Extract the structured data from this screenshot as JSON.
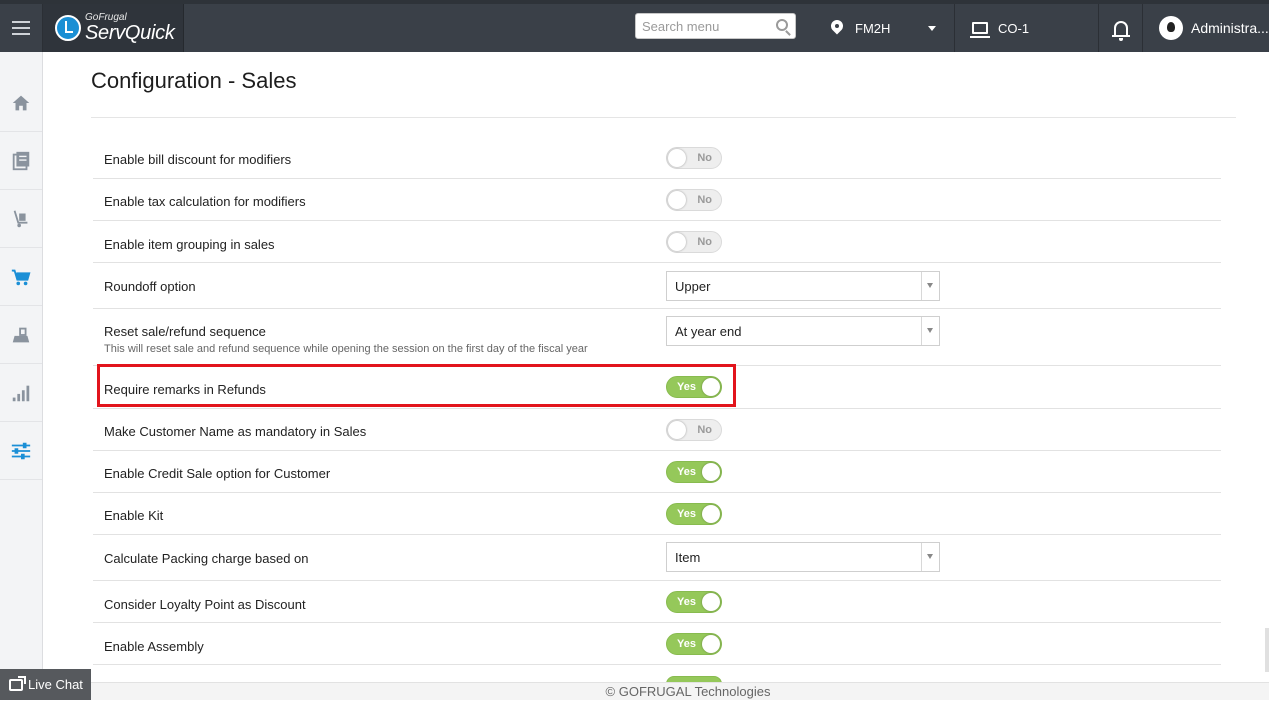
{
  "topbar": {
    "logo_small": "GoFrugal",
    "logo_big": "ServQuick",
    "search_placeholder": "Search menu",
    "location": "FM2H",
    "counter": "CO-1",
    "user": "Administra..."
  },
  "sidebar": {
    "items": [
      {
        "name": "home-icon"
      },
      {
        "name": "catalog-icon"
      },
      {
        "name": "inventory-icon"
      },
      {
        "name": "sales-cart-icon"
      },
      {
        "name": "purchase-icon"
      },
      {
        "name": "reports-icon"
      },
      {
        "name": "settings-icon"
      }
    ],
    "active": "settings-icon"
  },
  "page": {
    "title": "Configuration - Sales"
  },
  "settings": [
    {
      "label": "Enable bill discount for modifiers",
      "type": "toggle",
      "value": "No"
    },
    {
      "label": "Enable tax calculation for modifiers",
      "type": "toggle",
      "value": "No"
    },
    {
      "label": "Enable item grouping in sales",
      "type": "toggle",
      "value": "No"
    },
    {
      "label": "Roundoff option",
      "type": "select",
      "value": "Upper"
    },
    {
      "label": "Reset sale/refund sequence",
      "sublabel": "This will reset sale and refund sequence while opening the session on the first day of the fiscal year",
      "type": "select",
      "value": "At year end"
    },
    {
      "label": "Require remarks in Refunds",
      "type": "toggle",
      "value": "Yes"
    },
    {
      "label": "Make Customer Name as mandatory in Sales",
      "type": "toggle",
      "value": "No"
    },
    {
      "label": "Enable Credit Sale option for Customer",
      "type": "toggle",
      "value": "Yes"
    },
    {
      "label": "Enable Kit",
      "type": "toggle",
      "value": "Yes"
    },
    {
      "label": "Calculate Packing charge based on",
      "type": "select",
      "value": "Item"
    },
    {
      "label": "Consider Loyalty Point as Discount",
      "type": "toggle",
      "value": "Yes"
    },
    {
      "label": "Enable Assembly",
      "type": "toggle",
      "value": "Yes"
    }
  ],
  "footer": {
    "copyright": "© GOFRUGAL Technologies",
    "live_chat": "Live Chat"
  },
  "colors": {
    "topbar": "#3a4048",
    "toggle_on": "#95c85a",
    "highlight": "#e2141c",
    "sidebar_active": "#1b8fd6"
  }
}
